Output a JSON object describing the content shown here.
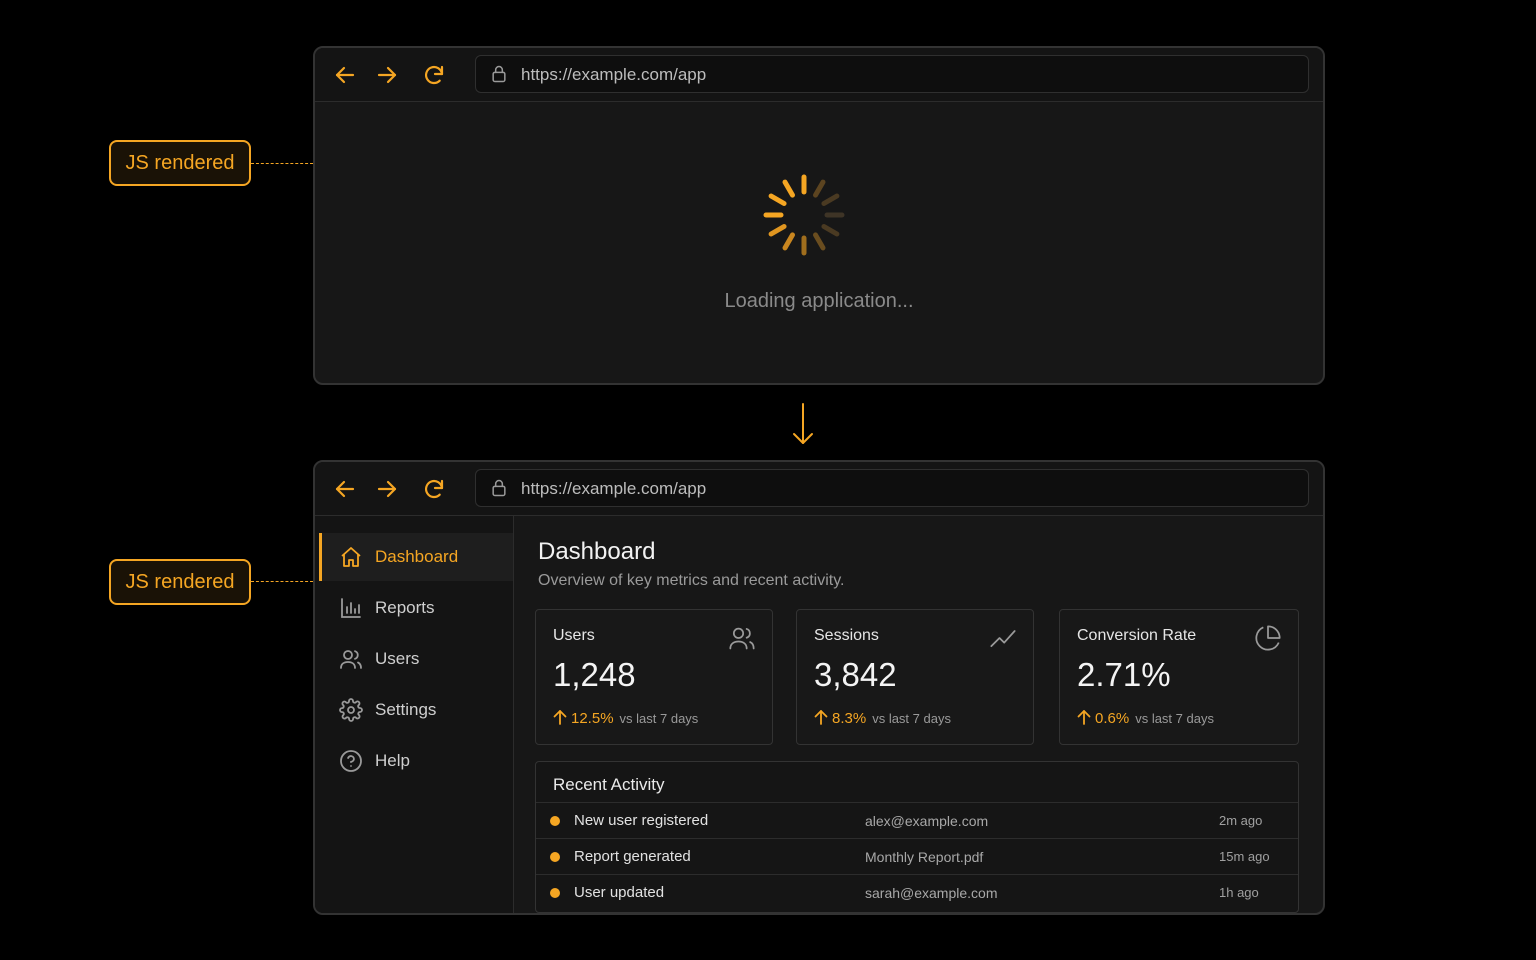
{
  "annotations": {
    "top_badge": "JS rendered",
    "bottom_badge": "JS rendered"
  },
  "colors": {
    "accent": "#f5a623",
    "background": "#000000",
    "window_bg": "#171717",
    "border": "#333333"
  },
  "browser_top": {
    "url": "https://example.com/app",
    "loading_text": "Loading application..."
  },
  "browser_bottom": {
    "url": "https://example.com/app"
  },
  "sidebar": {
    "items": [
      {
        "label": "Dashboard",
        "icon": "home-icon",
        "active": true
      },
      {
        "label": "Reports",
        "icon": "bar-chart-icon",
        "active": false
      },
      {
        "label": "Users",
        "icon": "users-icon",
        "active": false
      },
      {
        "label": "Settings",
        "icon": "gear-icon",
        "active": false
      },
      {
        "label": "Help",
        "icon": "help-circle-icon",
        "active": false
      }
    ]
  },
  "main": {
    "title": "Dashboard",
    "subtitle": "Overview of key metrics and recent activity.",
    "cards": [
      {
        "label": "Users",
        "value": "1,248",
        "delta": "12.5%",
        "compare": "vs last 7 days",
        "icon": "users-icon"
      },
      {
        "label": "Sessions",
        "value": "3,842",
        "delta": "8.3%",
        "compare": "vs last 7 days",
        "icon": "trend-line-icon"
      },
      {
        "label": "Conversion Rate",
        "value": "2.71%",
        "delta": "0.6%",
        "compare": "vs last 7 days",
        "icon": "pie-chart-icon"
      }
    ],
    "activity": {
      "title": "Recent Activity",
      "rows": [
        {
          "event": "New user registered",
          "detail": "alex@example.com",
          "time": "2m ago"
        },
        {
          "event": "Report generated",
          "detail": "Monthly Report.pdf",
          "time": "15m ago"
        },
        {
          "event": "User updated",
          "detail": "sarah@example.com",
          "time": "1h ago"
        }
      ]
    }
  }
}
